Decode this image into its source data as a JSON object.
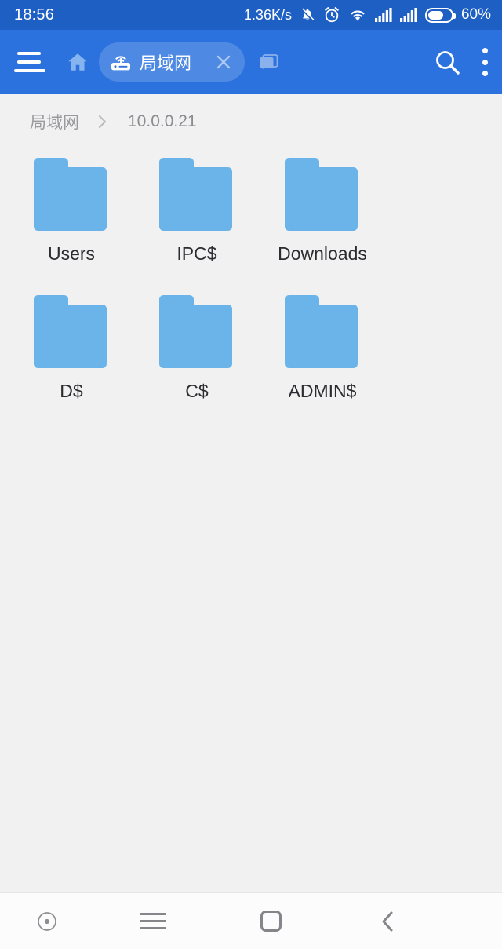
{
  "status_bar": {
    "clock": "18:56",
    "network_speed": "1.36K/s",
    "battery_percent": "60%",
    "icons": [
      "bell-muted-icon",
      "alarm-clock-icon",
      "wifi-icon",
      "signal-bars-icon",
      "signal-bars-icon",
      "battery-icon"
    ]
  },
  "toolbar": {
    "menu_icon": "hamburger-menu-icon",
    "home_icon": "home-icon",
    "active_tab": {
      "label": "局域网",
      "leading_icon": "router-icon",
      "close_icon": "close-icon"
    },
    "other_tab_icon": "tabs-stack-icon",
    "search_icon": "search-icon",
    "overflow_icon": "more-vertical-icon"
  },
  "breadcrumb": {
    "separator": "›",
    "items": [
      {
        "label": "局域网"
      },
      {
        "label": "10.0.0.21"
      }
    ]
  },
  "file_grid": {
    "items": [
      {
        "name": "Users",
        "icon": "folder-icon"
      },
      {
        "name": "IPC$",
        "icon": "folder-icon"
      },
      {
        "name": "Downloads",
        "icon": "folder-icon"
      },
      {
        "name": "D$",
        "icon": "folder-icon"
      },
      {
        "name": "C$",
        "icon": "folder-icon"
      },
      {
        "name": "ADMIN$",
        "icon": "folder-icon"
      }
    ]
  },
  "nav_bar": {
    "buttons": [
      {
        "name": "assistive-touch-icon"
      },
      {
        "name": "menu-icon"
      },
      {
        "name": "home-icon"
      },
      {
        "name": "back-icon"
      }
    ]
  },
  "colors": {
    "status_bar": "#1E5FC4",
    "toolbar": "#2B72DE",
    "content_bg": "#F1F1F2",
    "folder": "#6AB4EA",
    "label_text": "#2C2C30",
    "crumb_text": "#9A9A9E",
    "nav_icon": "#86868A"
  }
}
